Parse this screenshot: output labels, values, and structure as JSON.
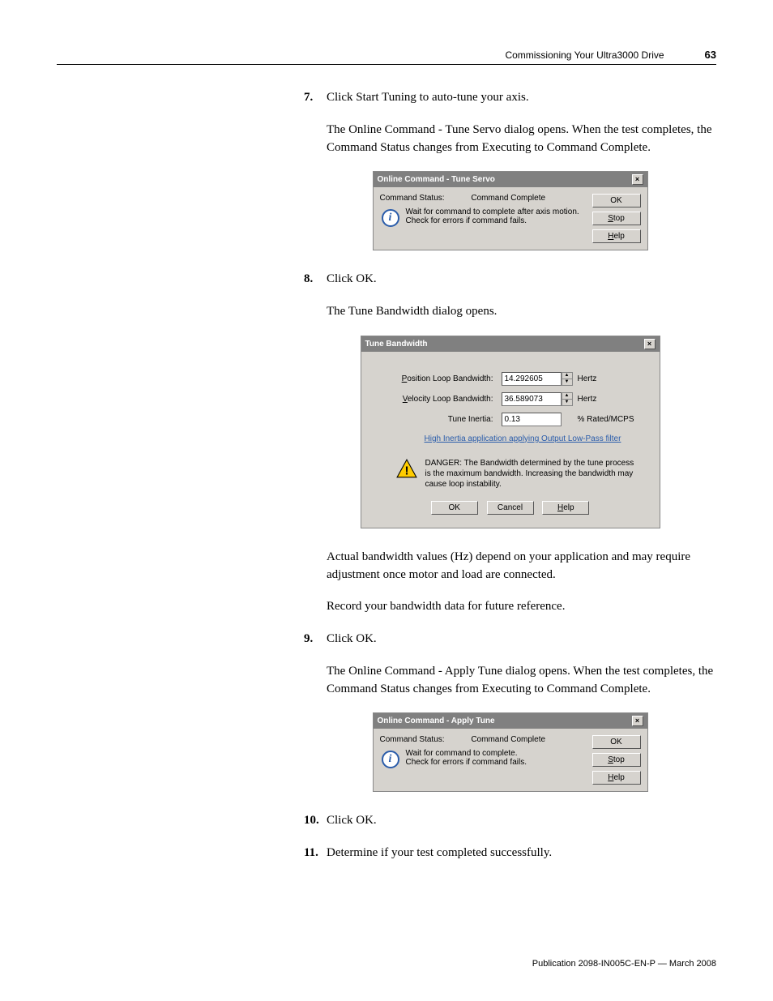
{
  "header": {
    "section_title": "Commissioning Your Ultra3000 Drive",
    "page_number": "63"
  },
  "steps": {
    "s7": {
      "num": "7.",
      "text": "Click Start Tuning to auto-tune your axis."
    },
    "s7_para": "The Online Command - Tune Servo dialog opens. When the test completes, the Command Status changes from Executing to Command Complete.",
    "s8": {
      "num": "8.",
      "text": "Click OK."
    },
    "s8_para": "The Tune Bandwidth dialog opens.",
    "s8_para2": "Actual bandwidth values (Hz) depend on your application and may require adjustment once motor and load are connected.",
    "s8_para3": "Record your bandwidth data for future reference.",
    "s9": {
      "num": "9.",
      "text": "Click OK."
    },
    "s9_para": "The Online Command - Apply Tune dialog opens. When the test completes, the Command Status changes from Executing to Command Complete.",
    "s10": {
      "num": "10.",
      "text": "Click OK."
    },
    "s11": {
      "num": "11.",
      "text": "Determine if your test completed successfully."
    }
  },
  "dialog_tune_servo": {
    "title": "Online Command - Tune Servo",
    "status_label": "Command Status:",
    "status_value": "Command Complete",
    "info_text": "Wait for command to complete after axis motion.\nCheck for errors if command fails.",
    "btn_ok": "OK",
    "btn_stop": "Stop",
    "btn_help": "Help"
  },
  "dialog_tune_bw": {
    "title": "Tune Bandwidth",
    "position_label": "Position Loop Bandwidth:",
    "position_value": "14.292605",
    "position_unit": "Hertz",
    "velocity_label": "Velocity Loop Bandwidth:",
    "velocity_value": "36.589073",
    "velocity_unit": "Hertz",
    "inertia_label": "Tune Inertia:",
    "inertia_value": "0.13",
    "inertia_unit": "% Rated/MCPS",
    "link_text": "High Inertia application applying Output Low-Pass filter",
    "warn_text": "DANGER: The Bandwidth determined by the tune process is the maximum bandwidth. Increasing the bandwidth may cause loop instability.",
    "btn_ok": "OK",
    "btn_cancel": "Cancel",
    "btn_help": "Help"
  },
  "dialog_apply_tune": {
    "title": "Online Command - Apply Tune",
    "status_label": "Command Status:",
    "status_value": "Command Complete",
    "info_text": "Wait for command to complete.\nCheck for errors if command fails.",
    "btn_ok": "OK",
    "btn_stop": "Stop",
    "btn_help": "Help"
  },
  "footer": "Publication 2098-IN005C-EN-P — March 2008"
}
